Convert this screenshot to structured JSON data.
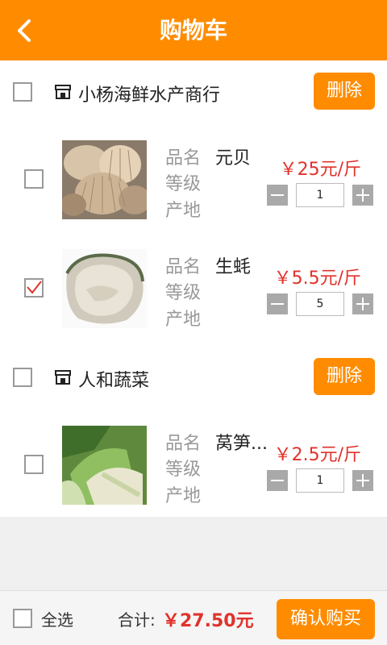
{
  "header": {
    "title": "购物车"
  },
  "shops": [
    {
      "name": "小杨海鲜水产商行",
      "delete_label": "删除",
      "items": [
        {
          "name_label": "品名",
          "name": "元贝",
          "grade_label": "等级",
          "origin_label": "产地",
          "price": "￥25元/斤",
          "qty": "1",
          "checked": false
        },
        {
          "name_label": "品名",
          "name": "生蚝",
          "grade_label": "等级",
          "origin_label": "产地",
          "price": "￥5.5元/斤",
          "qty": "5",
          "checked": true
        }
      ]
    },
    {
      "name": "人和蔬菜",
      "delete_label": "删除",
      "items": [
        {
          "name_label": "品名",
          "name": "莴笋...",
          "grade_label": "等级",
          "origin_label": "产地",
          "price": "￥2.5元/斤",
          "qty": "1",
          "checked": false
        }
      ]
    }
  ],
  "footer": {
    "select_all": "全选",
    "total_label": "合计:",
    "total_value": "￥27.50元",
    "buy_label": "确认购买"
  },
  "colors": {
    "accent": "#ff8c00",
    "price": "#e0322b",
    "check": "#e0322b"
  }
}
